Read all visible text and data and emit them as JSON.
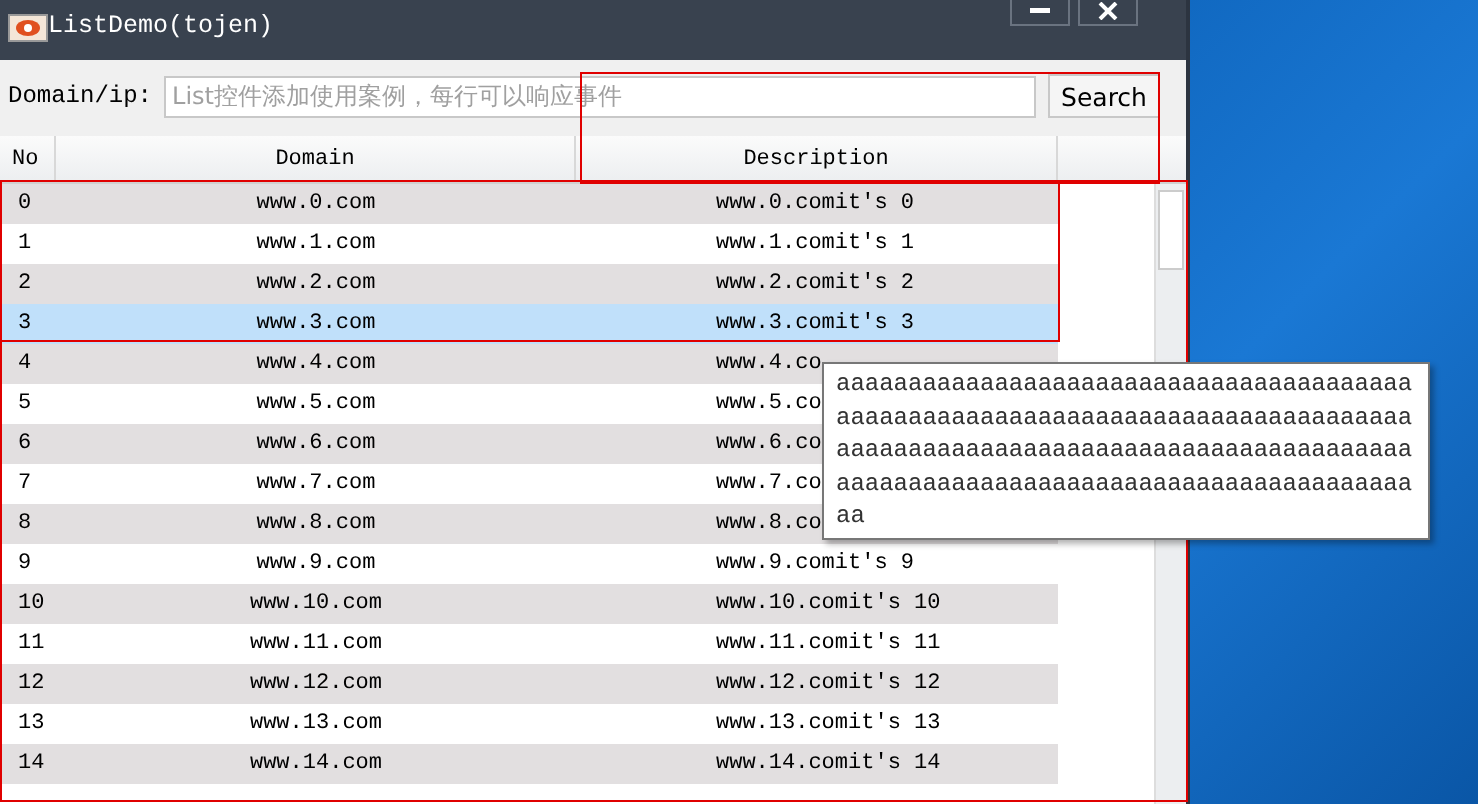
{
  "window": {
    "title": "ListDemo(tojen)",
    "buttons": [
      {
        "kind": "minimize"
      },
      {
        "kind": "close"
      }
    ]
  },
  "search": {
    "label": "Domain/ip:",
    "placeholder": "List控件添加使用案例，每行可以响应事件",
    "button": "Search"
  },
  "table": {
    "columns": [
      "No",
      "Domain",
      "Description"
    ],
    "rows": [
      {
        "no": "0",
        "domain": "www.0.com",
        "description": "www.0.comit's 0",
        "selected": false
      },
      {
        "no": "1",
        "domain": "www.1.com",
        "description": "www.1.comit's 1",
        "selected": false
      },
      {
        "no": "2",
        "domain": "www.2.com",
        "description": "www.2.comit's 2",
        "selected": false
      },
      {
        "no": "3",
        "domain": "www.3.com",
        "description": "www.3.comit's 3",
        "selected": true
      },
      {
        "no": "4",
        "domain": "www.4.com",
        "description": "www.4.co",
        "selected": false
      },
      {
        "no": "5",
        "domain": "www.5.com",
        "description": "www.5.co",
        "selected": false
      },
      {
        "no": "6",
        "domain": "www.6.com",
        "description": "www.6.co",
        "selected": false
      },
      {
        "no": "7",
        "domain": "www.7.com",
        "description": "www.7.co",
        "selected": false
      },
      {
        "no": "8",
        "domain": "www.8.com",
        "description": "www.8.co",
        "selected": false
      },
      {
        "no": "9",
        "domain": "www.9.com",
        "description": "www.9.comit's 9",
        "selected": false
      },
      {
        "no": "10",
        "domain": "www.10.com",
        "description": "www.10.comit's 10",
        "selected": false
      },
      {
        "no": "11",
        "domain": "www.11.com",
        "description": "www.11.comit's 11",
        "selected": false
      },
      {
        "no": "12",
        "domain": "www.12.com",
        "description": "www.12.comit's 12",
        "selected": false
      },
      {
        "no": "13",
        "domain": "www.13.com",
        "description": "www.13.comit's 13",
        "selected": false
      },
      {
        "no": "14",
        "domain": "www.14.com",
        "description": "www.14.comit's 14",
        "selected": false
      }
    ]
  },
  "tooltip": {
    "text": "aaaaaaaaaaaaaaaaaaaaaaaaaaaaaaaaaaaaaaaaaaaaaaaaaaaaaaaaaaaaaaaaaaaaaaaaaaaaaaaaaaaaaaaaaaaaaaaaaaaaaaaaaaaaaaaaaaaaaaaaaaaaaaaaaaaaaaaaaaaaaaaaaaaaaaaaaaaaaaaaaa"
  }
}
